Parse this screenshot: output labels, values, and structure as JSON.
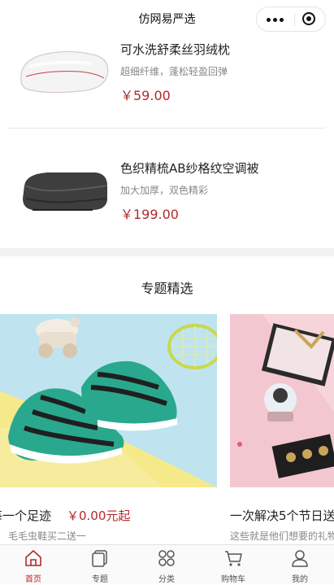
{
  "header": {
    "title": "仿网易严选"
  },
  "products": [
    {
      "name": "可水洗舒柔丝羽绒枕",
      "desc": "超细纤维，蓬松轻盈回弹",
      "price": "￥59.00"
    },
    {
      "name": "色织精梳AB纱格纹空调被",
      "desc": "加大加厚，双色精彩",
      "price": "￥199.00"
    }
  ],
  "topics": {
    "title": "专题精选",
    "cards": [
      {
        "name": "每一个足迹",
        "price": "￥0.00元起",
        "desc": "毛毛虫鞋买二送一"
      },
      {
        "name": "一次解决5个节日送",
        "price": "",
        "desc": "这些就是他们想要的礼物"
      }
    ]
  },
  "tabbar": [
    {
      "label": "首页",
      "icon": "home-icon",
      "active": true
    },
    {
      "label": "专题",
      "icon": "topic-icon",
      "active": false
    },
    {
      "label": "分类",
      "icon": "category-icon",
      "active": false
    },
    {
      "label": "购物车",
      "icon": "cart-icon",
      "active": false
    },
    {
      "label": "我的",
      "icon": "user-icon",
      "active": false
    }
  ],
  "colors": {
    "accent": "#b4282d",
    "muted": "#888888",
    "divider": "#e6e6e6"
  }
}
